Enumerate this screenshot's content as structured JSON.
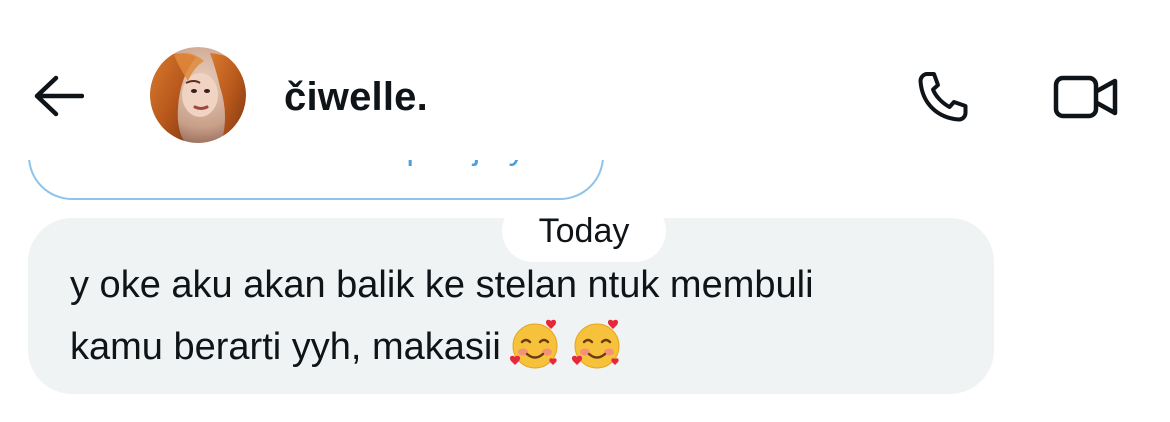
{
  "header": {
    "back_icon": "arrow-left-icon",
    "contact_name": "čiwelle.",
    "call_icon": "phone-icon",
    "video_icon": "video-camera-icon"
  },
  "conversation": {
    "previous_message_fragment": "wanisoon kon ama siapa aja ya",
    "date_divider": "Today",
    "messages": [
      {
        "direction": "incoming",
        "lines": [
          "y oke aku akan balik ke stelan ntuk membuli",
          "kamu berarti yyh, makasii"
        ],
        "emojis": [
          "smiling-face-with-hearts-icon",
          "smiling-face-with-hearts-icon"
        ]
      }
    ]
  },
  "colors": {
    "text": "#0f1419",
    "incoming_bubble": "#eff3f4",
    "outgoing_border": "#8ec3ea",
    "outgoing_text": "#4a9fe0",
    "background": "#ffffff"
  }
}
